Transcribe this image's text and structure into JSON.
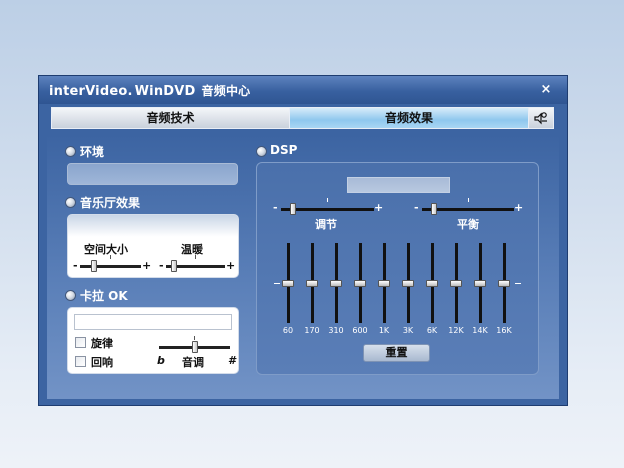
{
  "window": {
    "brand_part1": "interVideo.",
    "brand_part2": "WinDVD",
    "title": "音频中心",
    "close_label": "×"
  },
  "tabs": [
    {
      "label": "音频技术",
      "selected": false
    },
    {
      "label": "音频效果",
      "selected": true
    }
  ],
  "tab_icon": "speaker-settings-icon",
  "environment": {
    "label": "环境"
  },
  "concert_hall": {
    "label": "音乐厅效果",
    "space_size_label": "空间大小",
    "warmth_label": "温暖",
    "minus": "-",
    "plus": "+",
    "space_size_value": 0.2,
    "warmth_value": 0.1
  },
  "karaoke": {
    "label": "卡拉 OK",
    "melody_label": "旋律",
    "echo_label": "回响",
    "tone_label": "音调",
    "flat_symbol": "b",
    "sharp_symbol": "#",
    "melody_checked": false,
    "echo_checked": false,
    "tone_value": 0.5
  },
  "dsp": {
    "label": "DSP",
    "adjust_label": "调节",
    "balance_label": "平衡",
    "minus": "-",
    "plus": "+",
    "adjust_value": 0.1,
    "balance_value": 0.1,
    "bands": [
      "60",
      "170",
      "310",
      "600",
      "1K",
      "3K",
      "6K",
      "12K",
      "14K",
      "16K"
    ],
    "band_values": [
      0,
      0,
      0,
      0,
      0,
      0,
      0,
      0,
      0,
      0
    ],
    "reset_label": "重置"
  },
  "colors": {
    "window": "#3c64a2",
    "selected_tab": "#8fc7ee",
    "dsp_panel": "#4f74ad"
  }
}
